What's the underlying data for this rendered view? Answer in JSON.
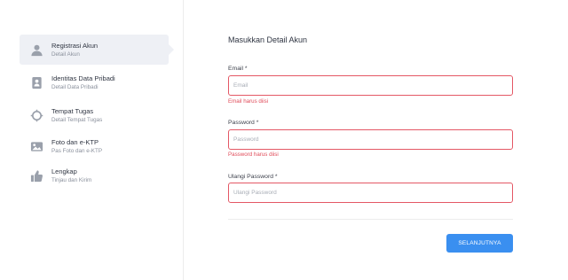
{
  "steps": [
    {
      "title": "Registrasi Akun",
      "subtitle": "Detail Akun",
      "icon": "user-icon",
      "active": true
    },
    {
      "title": "Identitas Data Pribadi",
      "subtitle": "Detail Data Pribadi",
      "icon": "id-card-icon",
      "active": false
    },
    {
      "title": "Tempat Tugas",
      "subtitle": "Detail Tempat Tugas",
      "icon": "location-icon",
      "active": false
    },
    {
      "title": "Foto dan e-KTP",
      "subtitle": "Pas Foto dan e-KTP",
      "icon": "image-icon",
      "active": false
    },
    {
      "title": "Lengkap",
      "subtitle": "Tinjau dan Kirim",
      "icon": "thumbs-up-icon",
      "active": false
    }
  ],
  "form": {
    "title": "Masukkan Detail Akun",
    "email_label": "Email *",
    "email_placeholder": "Email",
    "email_value": "",
    "email_error": "Email harus diisi",
    "password_label": "Password *",
    "password_placeholder": "Password",
    "password_value": "",
    "password_error": "Password harus diisi",
    "confirm_label": "Ulangi Password *",
    "confirm_placeholder": "Ulangi Password",
    "confirm_value": "",
    "submit_label": "SELANJUTNYA"
  },
  "colors": {
    "accent": "#3a8ff0",
    "error": "#e04c5a",
    "active_step_bg": "#eef0f5",
    "icon_gray": "#9aa0ab"
  }
}
